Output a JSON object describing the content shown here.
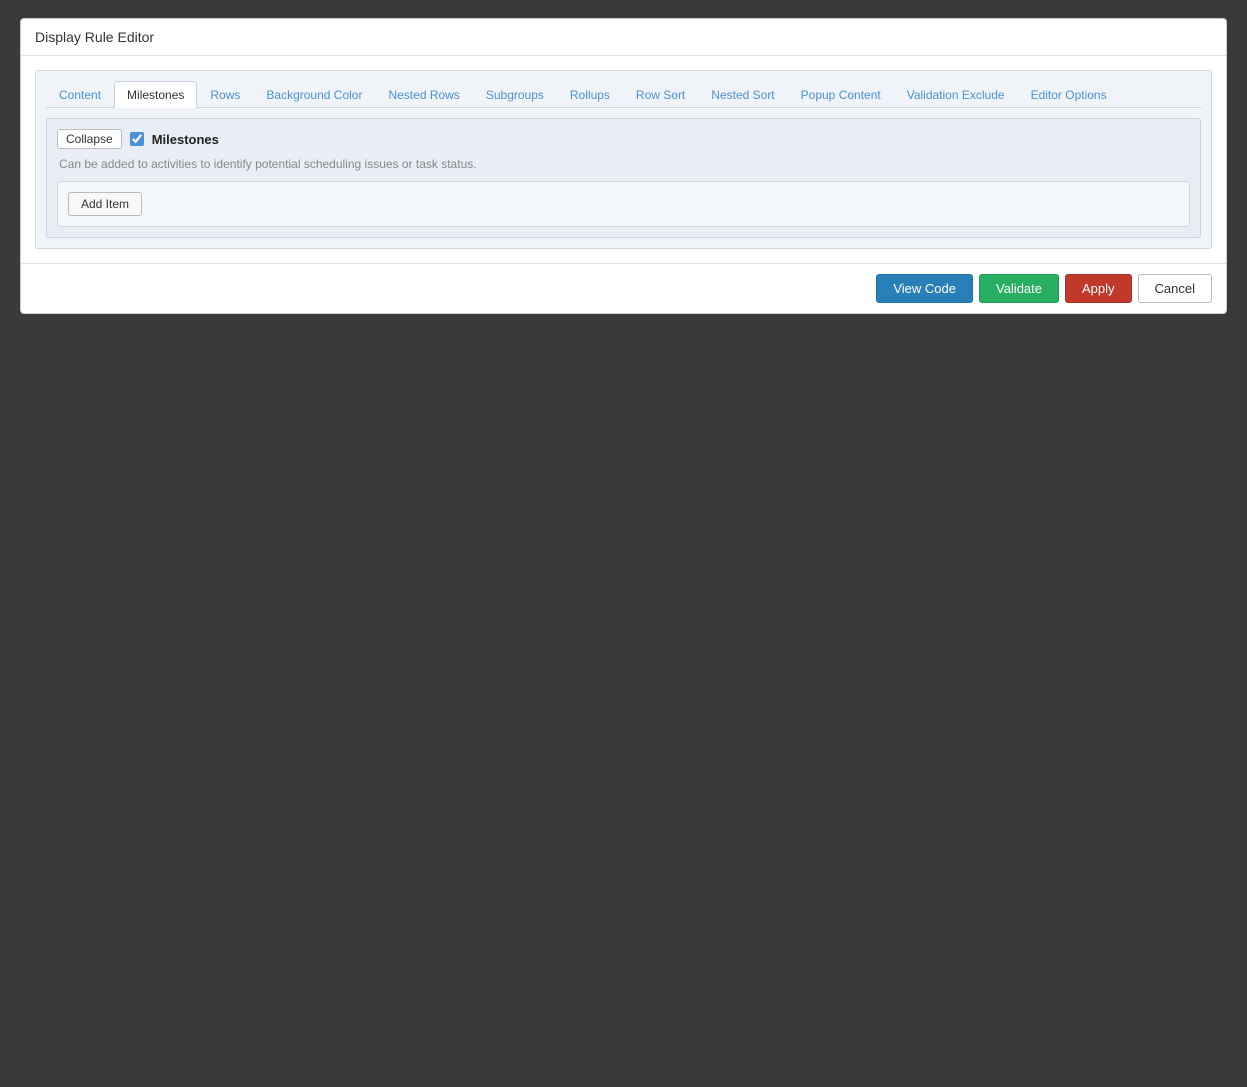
{
  "dialog": {
    "title": "Display Rule Editor"
  },
  "tabs": [
    {
      "label": "Content",
      "active": false
    },
    {
      "label": "Milestones",
      "active": true
    },
    {
      "label": "Rows",
      "active": false
    },
    {
      "label": "Background Color",
      "active": false
    },
    {
      "label": "Nested Rows",
      "active": false
    },
    {
      "label": "Subgroups",
      "active": false
    },
    {
      "label": "Rollups",
      "active": false
    },
    {
      "label": "Row Sort",
      "active": false
    },
    {
      "label": "Nested Sort",
      "active": false
    },
    {
      "label": "Popup Content",
      "active": false
    },
    {
      "label": "Validation Exclude",
      "active": false
    },
    {
      "label": "Editor Options",
      "active": false
    }
  ],
  "milestones_section": {
    "collapse_label": "Collapse",
    "checkbox_checked": true,
    "title": "Milestones",
    "description": "Can be added to activities to identify potential scheduling issues or task status.",
    "add_item_label": "Add Item"
  },
  "footer": {
    "view_code_label": "View Code",
    "validate_label": "Validate",
    "apply_label": "Apply",
    "cancel_label": "Cancel"
  }
}
